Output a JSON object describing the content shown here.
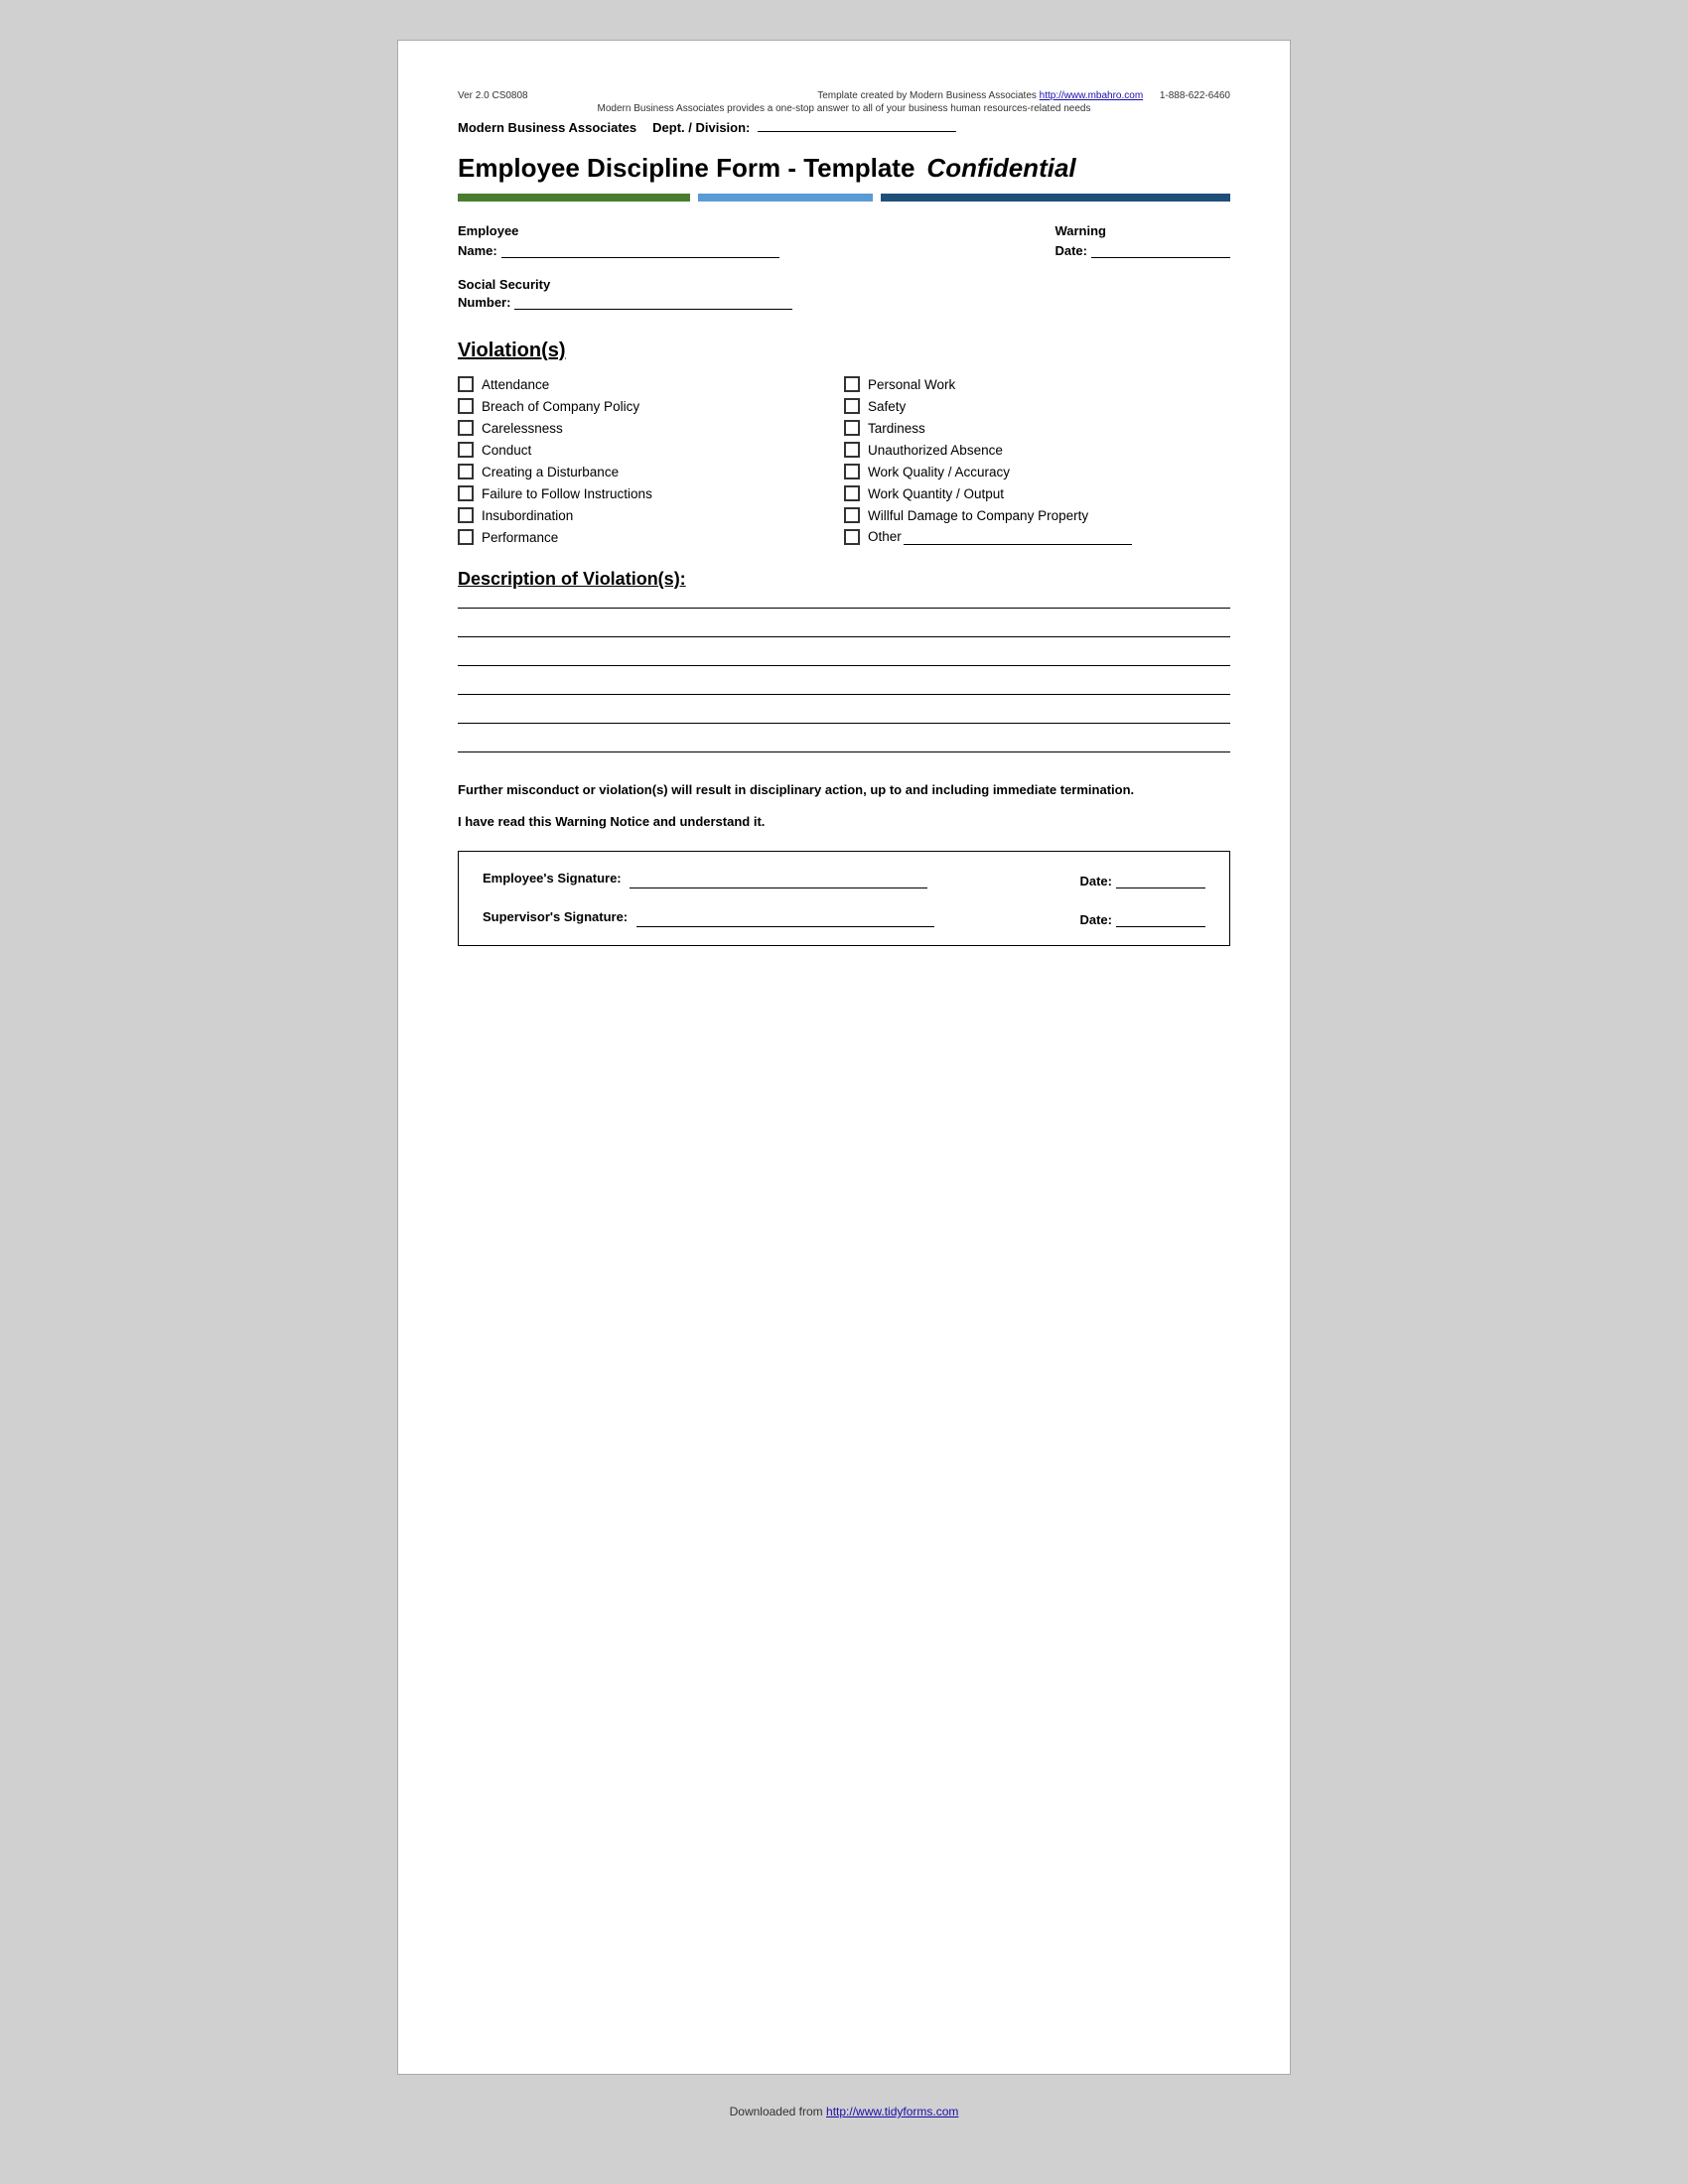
{
  "meta": {
    "version": "Ver 2.0 CS0808",
    "template_credit": "Template created by Modern Business Associates",
    "website": "http://www.mbahro.com",
    "phone": "1-888-622-6460",
    "subtitle": "Modern Business Associates provides a one-stop answer to all of your business human resources-related needs",
    "company": "Modern Business Associates",
    "dept_label": "Dept. / Division:"
  },
  "title": {
    "main": "Employee Discipline Form - Template",
    "confidential": "Confidential"
  },
  "fields": {
    "employee_name_label": "Employee",
    "employee_name_label2": "Name:",
    "warning_date_label": "Warning",
    "warning_date_label2": "Date:",
    "ssn_label": "Social Security",
    "ssn_label2": "Number:"
  },
  "violations": {
    "title": "Violation(s)",
    "left_items": [
      "Attendance",
      "Breach of Company Policy",
      "Carelessness",
      "Conduct",
      "Creating a Disturbance",
      "Failure to Follow Instructions",
      "Insubordination",
      "Performance"
    ],
    "right_items": [
      "Personal Work",
      "Safety",
      "Tardiness",
      "Unauthorized Absence",
      "Work Quality / Accuracy",
      "Work Quantity / Output",
      "Willful Damage to Company Property",
      "Other"
    ]
  },
  "description": {
    "title": "Description of Violation(s):"
  },
  "warning_notice": {
    "text": "Further misconduct or violation(s) will result in disciplinary action, up to and including immediate termination."
  },
  "read_notice": {
    "text": "I have read this Warning Notice and understand it."
  },
  "signatures": {
    "employee_label": "Employee's Signature:",
    "employee_date_label": "Date:",
    "supervisor_label": "Supervisor's Signature:",
    "supervisor_date_label": "Date:"
  },
  "footer": {
    "text": "Downloaded from",
    "link": "http://www.tidyforms.com"
  }
}
